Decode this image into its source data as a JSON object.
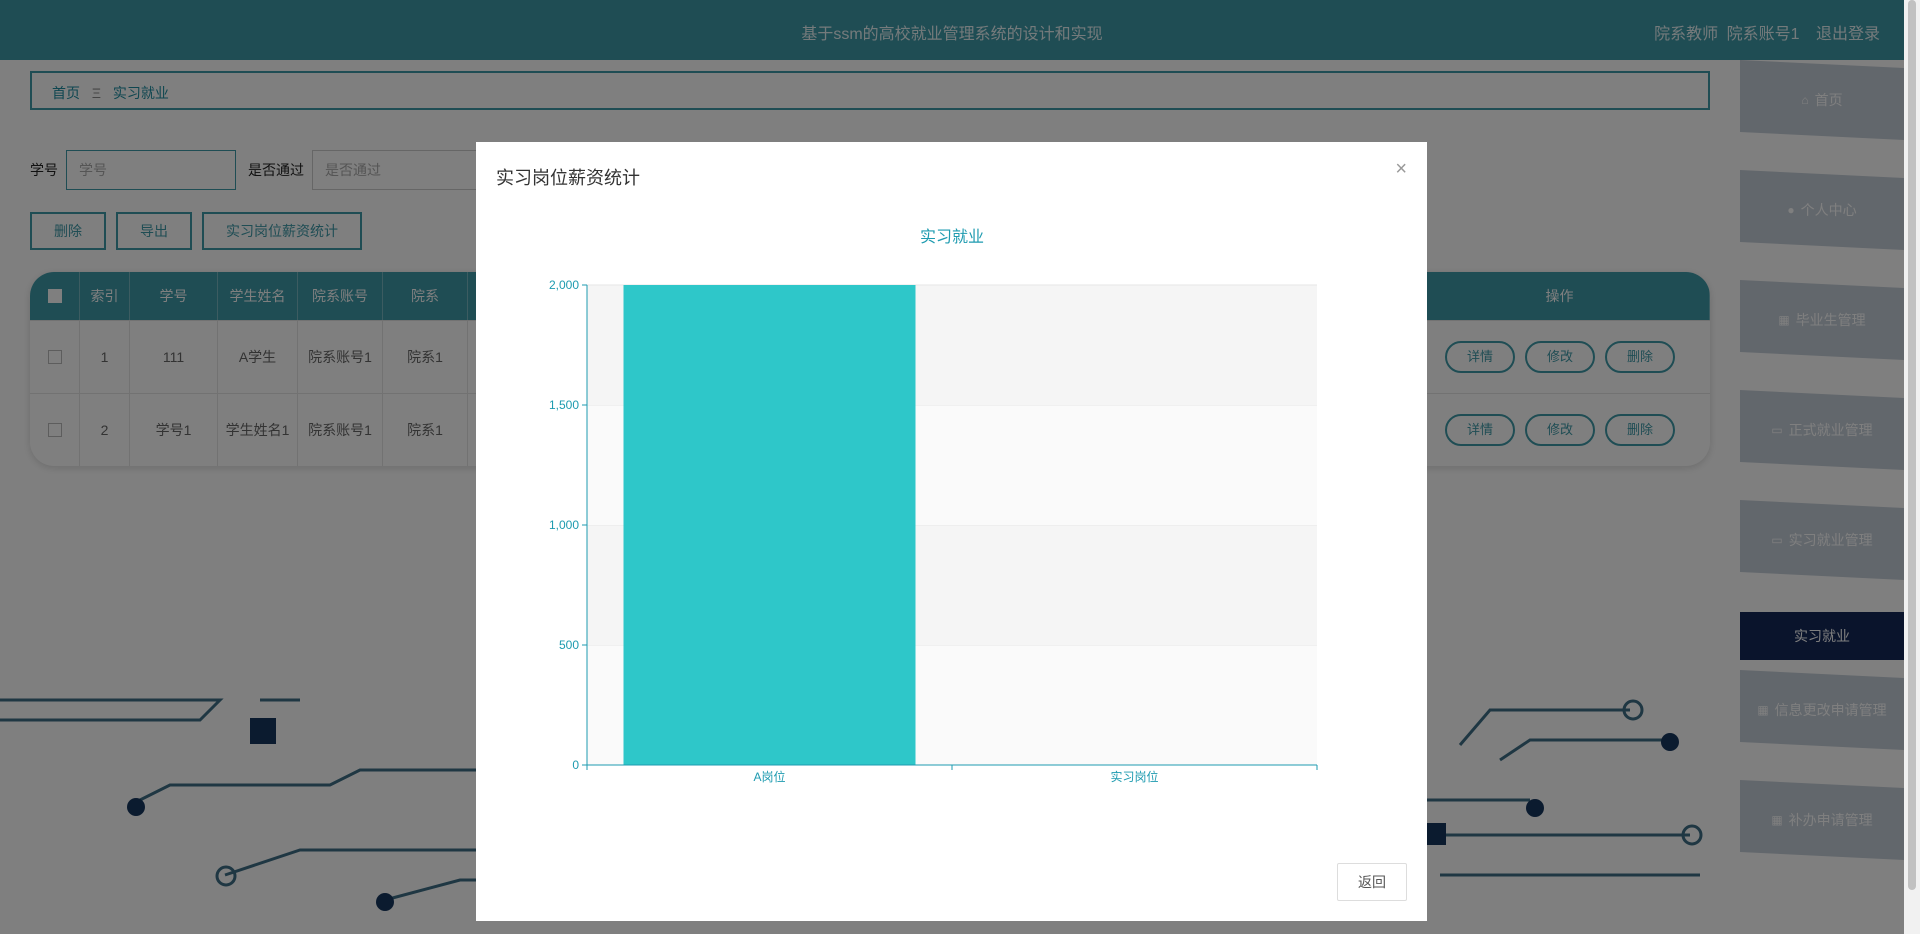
{
  "header": {
    "title": "基于ssm的高校就业管理系统的设计和实现",
    "role": "院系教师",
    "account": "院系账号1",
    "logout_label": "退出登录"
  },
  "breadcrumb": {
    "home": "首页",
    "separator": "Ξ",
    "current": "实习就业"
  },
  "search": {
    "student_id_label": "学号",
    "student_id_placeholder": "学号",
    "passed_label": "是否通过",
    "passed_placeholder": "是否通过"
  },
  "actions": {
    "delete_label": "删除",
    "export_label": "导出",
    "stats_label": "实习岗位薪资统计"
  },
  "table": {
    "headers": [
      "索引",
      "学号",
      "学生姓名",
      "院系账号",
      "院系",
      "操作"
    ],
    "rows": [
      {
        "index": "1",
        "student_id": "111",
        "student_name": "A学生",
        "dept_account": "院系账号1",
        "dept": "院系1"
      },
      {
        "index": "2",
        "student_id": "学号1",
        "student_name": "学生姓名1",
        "dept_account": "院系账号1",
        "dept": "院系1"
      }
    ],
    "op_labels": {
      "detail": "详情",
      "edit": "修改",
      "delete": "删除"
    }
  },
  "sidenav": {
    "items": [
      {
        "label": "首页",
        "icon": "home-icon"
      },
      {
        "label": "个人中心",
        "icon": "user-icon"
      },
      {
        "label": "毕业生管理",
        "icon": "grid-icon"
      },
      {
        "label": "正式就业管理",
        "icon": "monitor-icon"
      },
      {
        "label": "实习就业管理",
        "icon": "monitor-icon"
      },
      {
        "label": "实习就业",
        "icon": ""
      },
      {
        "label": "信息更改申请管理",
        "icon": "grid-icon"
      },
      {
        "label": "补办申请管理",
        "icon": "grid-icon"
      }
    ],
    "active_index": 5
  },
  "modal": {
    "title": "实习岗位薪资统计",
    "close_icon": "close-icon",
    "back_label": "返回"
  },
  "chart_data": {
    "type": "bar",
    "title": "实习就业",
    "categories": [
      "A岗位",
      "实习岗位"
    ],
    "values": [
      2000,
      0
    ],
    "ylim": [
      0,
      2000
    ],
    "yticks": [
      0,
      500,
      1000,
      1500,
      2000
    ],
    "ytick_labels": [
      "0",
      "500",
      "1,000",
      "1,500",
      "2,000"
    ],
    "xlabel": "",
    "ylabel": "",
    "grid": true,
    "bar_color": "#2ec7c9",
    "axis_color": "#1e9bb0"
  },
  "colors": {
    "primary": "#3e9aa9",
    "nav_active": "#152859"
  }
}
